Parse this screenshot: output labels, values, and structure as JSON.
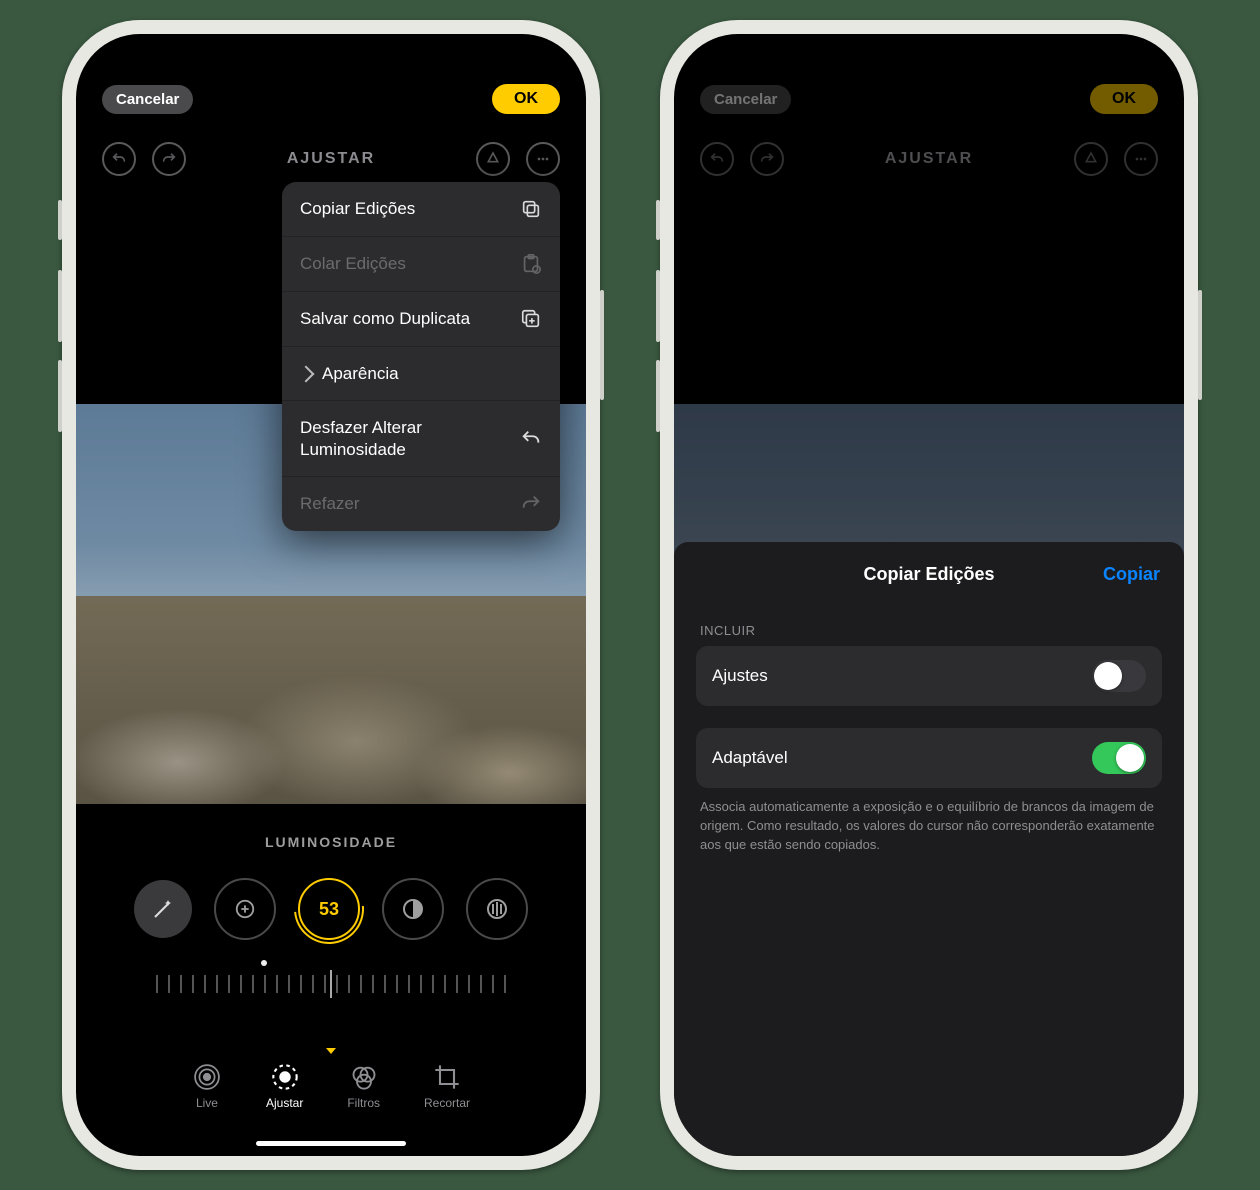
{
  "left": {
    "cancel": "Cancelar",
    "ok": "OK",
    "title": "AJUSTAR",
    "menu": {
      "copy": "Copiar Edições",
      "paste": "Colar Edições",
      "save_duplicate": "Salvar como Duplicata",
      "appearance": "Aparência",
      "undo": "Desfazer Alterar Luminosidade",
      "redo": "Refazer"
    },
    "adj_name": "LUMINOSIDADE",
    "adj_value": "53",
    "tabs": {
      "live": "Live",
      "adjust": "Ajustar",
      "filters": "Filtros",
      "crop": "Recortar"
    }
  },
  "right": {
    "cancel": "Cancelar",
    "ok": "OK",
    "title": "AJUSTAR",
    "sheet": {
      "title": "Copiar Edições",
      "action": "Copiar",
      "section_label": "INCLUIR",
      "row_adjustments": "Ajustes",
      "row_adaptive": "Adaptável",
      "note": "Associa automaticamente a exposição e o equilíbrio de brancos da imagem de origem. Como resultado, os valores do cursor não corresponderão exatamente aos que estão sendo copiados."
    }
  }
}
